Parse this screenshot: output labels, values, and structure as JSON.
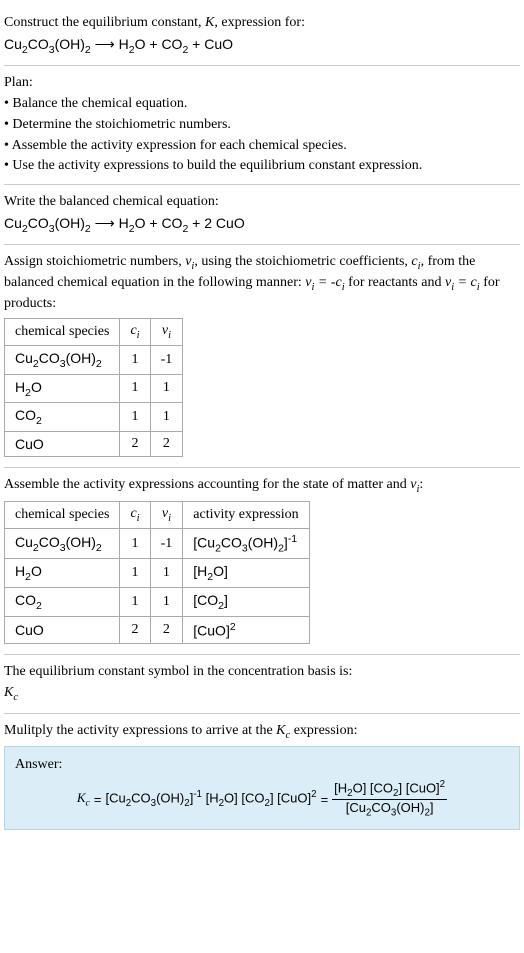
{
  "prompt": {
    "lead": "Construct the equilibrium constant, ",
    "K": "K",
    "tail": ", expression for:"
  },
  "equation_unbalanced": {
    "lhs": "Cu2CO3(OH)2",
    "arrow": "⟶",
    "rhs": "H2O + CO2 + CuO"
  },
  "plan_heading": "Plan:",
  "plan_items": [
    "• Balance the chemical equation.",
    "• Determine the stoichiometric numbers.",
    "• Assemble the activity expression for each chemical species.",
    "• Use the activity expressions to build the equilibrium constant expression."
  ],
  "balanced_heading": "Write the balanced chemical equation:",
  "equation_balanced": {
    "lhs": "Cu2CO3(OH)2",
    "arrow": "⟶",
    "rhs": "H2O + CO2 + 2 CuO"
  },
  "stoich_intro": {
    "p1": "Assign stoichiometric numbers, ",
    "nu": "ν",
    "sub_i": "i",
    "p2": ", using the stoichiometric coefficients, ",
    "c": "c",
    "p3": ", from the balanced chemical equation in the following manner: ",
    "rel1a": "ν",
    "rel1b": " = -c",
    "rel1c": " for reactants and ",
    "rel2a": "ν",
    "rel2b": " = c",
    "rel2c": " for products:"
  },
  "table1": {
    "headers": [
      "chemical species",
      "c_i",
      "ν_i"
    ],
    "rows": [
      [
        "Cu2CO3(OH)2",
        "1",
        "-1"
      ],
      [
        "H2O",
        "1",
        "1"
      ],
      [
        "CO2",
        "1",
        "1"
      ],
      [
        "CuO",
        "2",
        "2"
      ]
    ]
  },
  "activity_intro": {
    "p1": "Assemble the activity expressions accounting for the state of matter and ",
    "nu": "ν",
    "sub_i": "i",
    "colon": ":"
  },
  "table2": {
    "headers": [
      "chemical species",
      "c_i",
      "ν_i",
      "activity expression"
    ],
    "rows": [
      {
        "sp": "Cu2CO3(OH)2",
        "c": "1",
        "nu": "-1",
        "act": "[Cu2CO3(OH)2]",
        "exp": "-1"
      },
      {
        "sp": "H2O",
        "c": "1",
        "nu": "1",
        "act": "[H2O]",
        "exp": ""
      },
      {
        "sp": "CO2",
        "c": "1",
        "nu": "1",
        "act": "[CO2]",
        "exp": ""
      },
      {
        "sp": "CuO",
        "c": "2",
        "nu": "2",
        "act": "[CuO]",
        "exp": "2"
      }
    ]
  },
  "kc_symbol_line": "The equilibrium constant symbol in the concentration basis is:",
  "kc_symbol": "K",
  "kc_sub": "c",
  "multiply_line": {
    "p1": "Mulitply the activity expressions to arrive at the ",
    "K": "K",
    "sub": "c",
    "p2": " expression:"
  },
  "answer_label": "Answer:",
  "answer": {
    "lhs_K": "K",
    "lhs_sub": "c",
    "eq": " = ",
    "t1": "[Cu2CO3(OH)2]",
    "t1exp": "-1",
    "t2": " [H2O] [CO2] [CuO]",
    "t2exp": "2",
    "eq2": " = ",
    "num": "[H2O] [CO2] [CuO]",
    "numexp": "2",
    "den": "[Cu2CO3(OH)2]"
  }
}
